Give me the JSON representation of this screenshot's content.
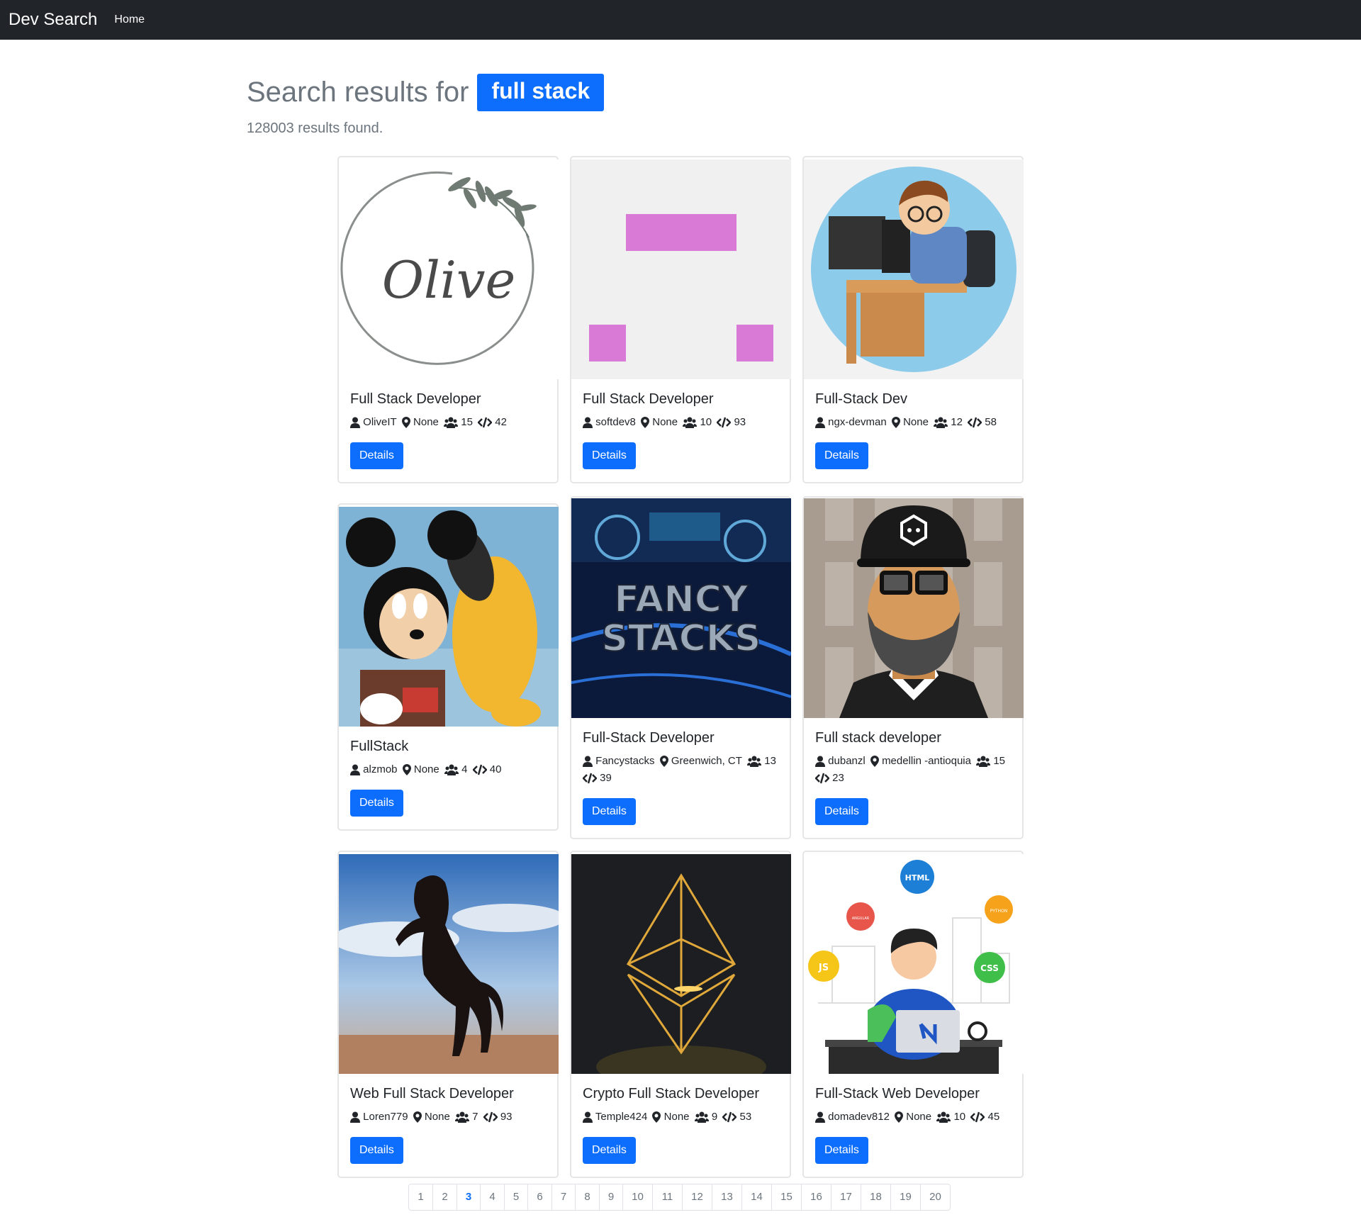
{
  "navbar": {
    "brand": "Dev Search",
    "home_link": "Home"
  },
  "search": {
    "heading": "Search results for",
    "query": "full stack",
    "results_count": "128003 results found."
  },
  "cards": [
    {
      "title": "Full Stack Developer",
      "username": "OliveIT",
      "location": "None",
      "followers": "15",
      "projects": "42",
      "button": "Details",
      "image": "olive-logo"
    },
    {
      "title": "Full Stack Developer",
      "username": "softdev8",
      "location": "None",
      "followers": "10",
      "projects": "93",
      "button": "Details",
      "image": "pink-blocks-avatar"
    },
    {
      "title": "Full-Stack Dev",
      "username": "ngx-devman",
      "location": "None",
      "followers": "12",
      "projects": "58",
      "button": "Details",
      "image": "developer-cartoon"
    },
    {
      "title": "FullStack",
      "username": "alzmob",
      "location": "None",
      "followers": "4",
      "projects": "40",
      "button": "Details",
      "image": "cartoon-mouse-and-dog"
    },
    {
      "title": "Full-Stack Developer",
      "username": "Fancystacks",
      "location": "Greenwich, CT",
      "followers": "13",
      "projects": "39",
      "button": "Details",
      "image": "fancy-stacks-logo",
      "image_text": "FANCY STACKS"
    },
    {
      "title": "Full stack developer",
      "username": "dubanzl",
      "location": "medellin -antioquia",
      "followers": "15",
      "projects": "23",
      "button": "Details",
      "image": "bearded-man-avatar"
    },
    {
      "title": "Web Full Stack Developer",
      "username": "Loren779",
      "location": "None",
      "followers": "7",
      "projects": "93",
      "button": "Details",
      "image": "rearing-horse"
    },
    {
      "title": "Crypto Full Stack Developer",
      "username": "Temple424",
      "location": "None",
      "followers": "9",
      "projects": "53",
      "button": "Details",
      "image": "ethereum-logo"
    },
    {
      "title": "Full-Stack Web Developer",
      "username": "domadev812",
      "location": "None",
      "followers": "10",
      "projects": "45",
      "button": "Details",
      "image": "web-developer-illustration",
      "image_badges": [
        "HTML",
        "PYTHON",
        "ANGULAR",
        "JS",
        "CSS"
      ]
    }
  ],
  "pagination": {
    "pages": [
      "1",
      "2",
      "3",
      "4",
      "5",
      "6",
      "7",
      "8",
      "9",
      "10",
      "11",
      "12",
      "13",
      "14",
      "15",
      "16",
      "17",
      "18",
      "19",
      "20"
    ],
    "active": "3"
  },
  "colors": {
    "navbar": "#212529",
    "primary": "#0d6efd",
    "muted": "#6c757d"
  },
  "icons": {
    "user": "user-icon",
    "location": "map-marker-icon",
    "followers": "users-icon",
    "projects": "code-icon"
  }
}
